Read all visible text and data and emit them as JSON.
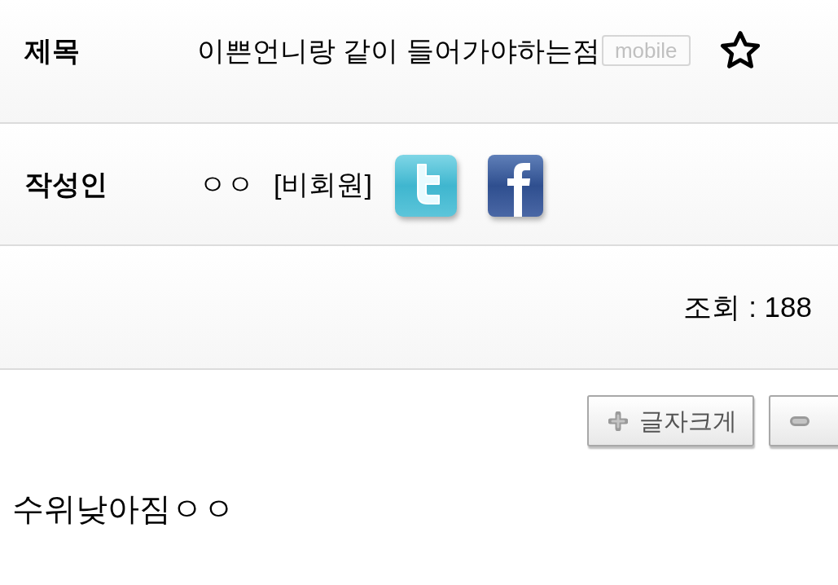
{
  "title_row": {
    "label": "제목",
    "title": "이쁜언니랑 같이 들어가야하는점",
    "badge": "mobile",
    "starred": false
  },
  "author_row": {
    "label": "작성인",
    "name": "ㅇㅇ",
    "member_status": "[비회원]",
    "share_links": [
      {
        "kind": "twitter"
      },
      {
        "kind": "facebook"
      }
    ]
  },
  "views": "조회 : 188",
  "font_buttons": [
    {
      "kind": "increase",
      "label": "글자크게"
    },
    {
      "kind": "decrease"
    }
  ],
  "body": "수위낮아짐ㅇㅇ"
}
